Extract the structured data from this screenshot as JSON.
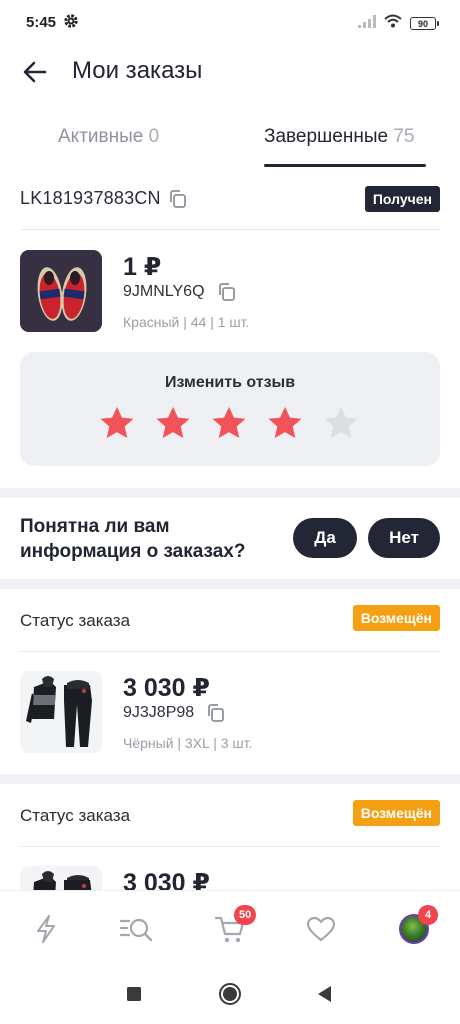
{
  "status_bar": {
    "time": "5:45",
    "battery": "90"
  },
  "header": {
    "title": "Мои заказы"
  },
  "tabs": [
    {
      "label": "Активные",
      "count": "0"
    },
    {
      "label": "Завершенные",
      "count": "75"
    }
  ],
  "order1": {
    "track_number": "LK181937883CN",
    "status_badge": "Получен",
    "price": "1 ₽",
    "code": "9JMNLY6Q",
    "meta": "Красный | 44 | 1 шт.",
    "review": {
      "title": "Изменить отзыв",
      "rating": 4,
      "max": 5
    }
  },
  "feedback": {
    "question": "Понятна ли вам информация о заказах?",
    "yes": "Да",
    "no": "Нет"
  },
  "order2": {
    "status_label": "Статус заказа",
    "status_badge": "Возмещён",
    "price": "3 030 ₽",
    "code": "9J3J8P98",
    "meta": "Чёрный | 3XL | 3 шт."
  },
  "order3": {
    "status_label": "Статус заказа",
    "status_badge": "Возмещён",
    "price": "3 030 ₽"
  },
  "bottom_nav": {
    "cart_badge": "50",
    "profile_badge": "4",
    "icons": [
      "flash-icon",
      "catalog-search-icon",
      "cart-icon",
      "heart-icon",
      "avatar"
    ]
  },
  "colors": {
    "accent_dark": "#232735",
    "star_active": "#f0535a",
    "star_inactive": "#dcdee3",
    "badge_orange": "#f59f12",
    "badge_red": "#f1444f"
  }
}
